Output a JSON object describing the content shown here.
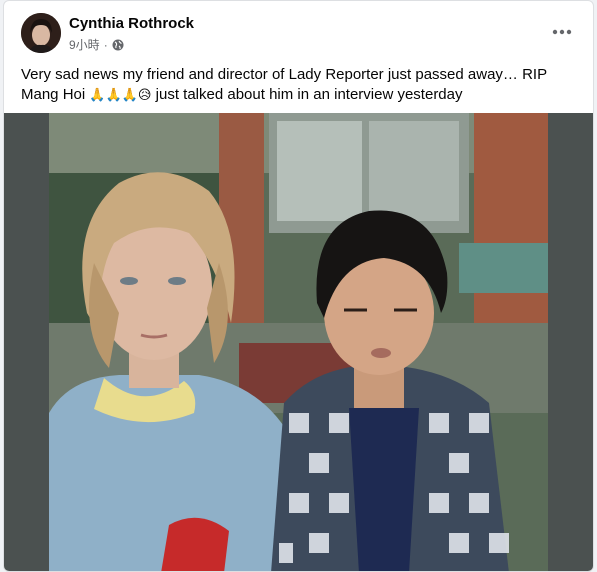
{
  "post": {
    "author": "Cynthia Rothrock",
    "timestamp": "9小時",
    "separator": "·",
    "privacy_icon": "globe-icon",
    "more_icon": "more-options-icon",
    "text_main": "Very sad news my friend and director of Lady Reporter just passed away… RIP Mang Hoi ",
    "emojis": "🙏🙏🙏😥",
    "text_tail": " just talked about him in an interview yesterday"
  },
  "colors": {
    "post_background": "#ffffff",
    "page_background": "#f0f2f5",
    "author_text": "#050505",
    "meta_text": "#65676b",
    "photo_letterbox": "#4b5150"
  }
}
